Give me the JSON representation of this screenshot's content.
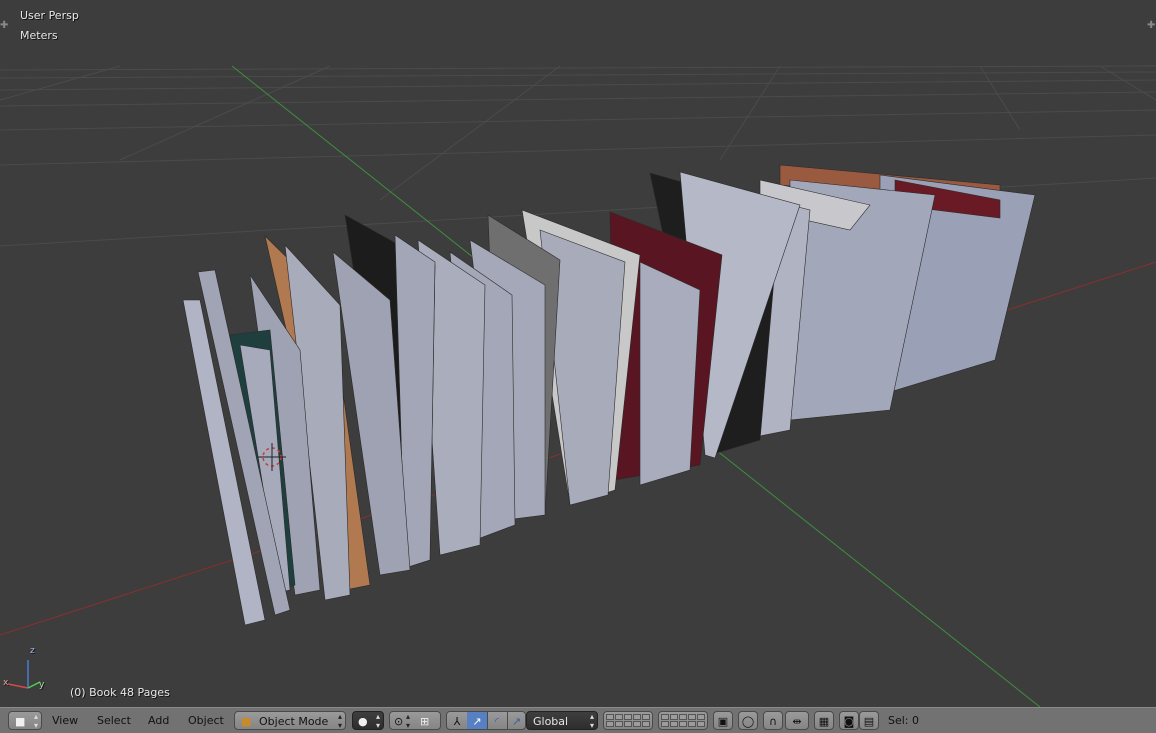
{
  "viewport": {
    "view_name": "User Persp",
    "units": "Meters",
    "object_info": "(0) Book 48 Pages",
    "axis_labels": {
      "x": "x",
      "y": "y",
      "z": "z"
    }
  },
  "header": {
    "editor_type_icon": "cube-icon",
    "menus": [
      "View",
      "Select",
      "Add",
      "Object"
    ],
    "mode": "Object Mode",
    "shading_icon": "sphere-icon",
    "pivot_icon": "pivot-icon",
    "orientation": "Global",
    "selection_info": "Sel: 0"
  },
  "colors": {
    "background": "#3d3d3d",
    "grid": "#4a4a4a",
    "x_axis": "#8a2f2f",
    "y_axis": "#3f8f3f",
    "header": "#727272",
    "active_button": "#5680c2"
  }
}
